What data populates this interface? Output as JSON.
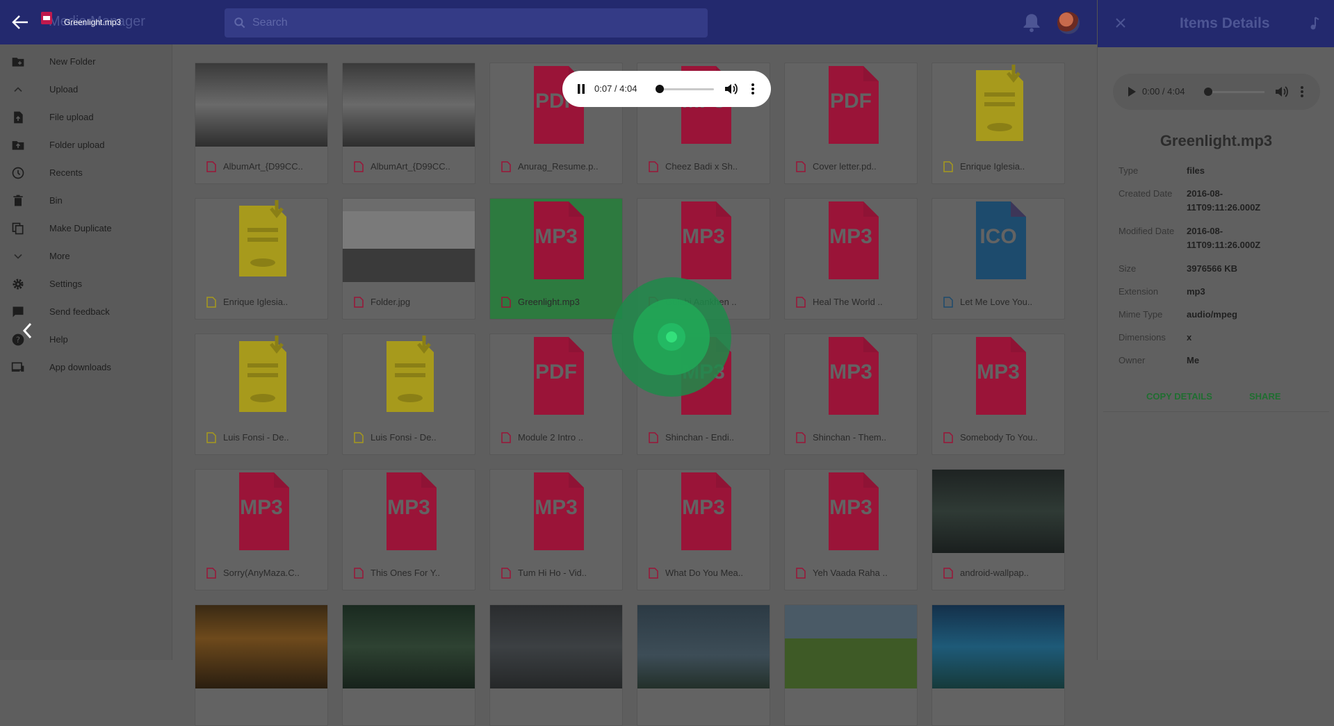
{
  "topbar": {
    "app_title_behind": "Media Manager",
    "player_title": "Greenlight.mp3",
    "search_placeholder": "Search"
  },
  "sidebar": {
    "items": [
      {
        "label": "New Folder",
        "icon": "new-folder-icon"
      },
      {
        "label": "Upload",
        "icon": "chevron-up-icon"
      },
      {
        "label": "File upload",
        "icon": "file-upload-icon"
      },
      {
        "label": "Folder upload",
        "icon": "folder-upload-icon"
      },
      {
        "label": "Recents",
        "icon": "clock-icon"
      },
      {
        "label": "Bin",
        "icon": "trash-icon"
      },
      {
        "label": "Make Duplicate",
        "icon": "copy-icon"
      },
      {
        "label": "More",
        "icon": "chevron-down-icon"
      },
      {
        "label": "Settings",
        "icon": "gear-icon"
      },
      {
        "label": "Send feedback",
        "icon": "feedback-icon"
      },
      {
        "label": "Help",
        "icon": "help-icon"
      },
      {
        "label": "App downloads",
        "icon": "devices-icon"
      }
    ]
  },
  "files": [
    {
      "name": "AlbumArt_{D99CC..",
      "kind": "photo-bw"
    },
    {
      "name": "AlbumArt_{D99CC..",
      "kind": "photo-bw"
    },
    {
      "name": "Anurag_Resume.p..",
      "kind": "pdf",
      "badge": "PDF"
    },
    {
      "name": "Cheez Badi x Sh..",
      "kind": "mp3",
      "badge": "MP3"
    },
    {
      "name": "Cover letter.pd..",
      "kind": "pdf",
      "badge": "PDF"
    },
    {
      "name": "Enrique Iglesia..",
      "kind": "doc"
    },
    {
      "name": "Enrique Iglesia..",
      "kind": "doc"
    },
    {
      "name": "Folder.jpg",
      "kind": "photo-band"
    },
    {
      "name": "Greenlight.mp3",
      "kind": "mp3",
      "badge": "MP3",
      "selected": true
    },
    {
      "name": "Gulabi Aankhen ..",
      "kind": "mp3",
      "badge": "MP3"
    },
    {
      "name": "Heal The World ..",
      "kind": "mp3",
      "badge": "MP3"
    },
    {
      "name": "Let Me Love You..",
      "kind": "ico",
      "badge": "ICO"
    },
    {
      "name": "Luis Fonsi - De..",
      "kind": "doc"
    },
    {
      "name": "Luis Fonsi - De..",
      "kind": "doc"
    },
    {
      "name": "Module 2 Intro ..",
      "kind": "pdf",
      "badge": "PDF"
    },
    {
      "name": "Shinchan - Endi..",
      "kind": "mp3",
      "badge": "MP3"
    },
    {
      "name": "Shinchan - Them..",
      "kind": "mp3",
      "badge": "MP3"
    },
    {
      "name": "Somebody To You..",
      "kind": "mp3",
      "badge": "MP3"
    },
    {
      "name": "Sorry(AnyMaza.C..",
      "kind": "mp3",
      "badge": "MP3"
    },
    {
      "name": "This Ones For Y..",
      "kind": "mp3",
      "badge": "MP3"
    },
    {
      "name": "Tum Hi Ho - Vid..",
      "kind": "mp3",
      "badge": "MP3"
    },
    {
      "name": "What Do You Mea..",
      "kind": "mp3",
      "badge": "MP3"
    },
    {
      "name": "Yeh Vaada Raha ..",
      "kind": "mp3",
      "badge": "MP3"
    },
    {
      "name": "android-wallpap..",
      "kind": "photo-road"
    },
    {
      "name": "",
      "kind": "photo-sunset"
    },
    {
      "name": "",
      "kind": "photo-forest"
    },
    {
      "name": "",
      "kind": "photo-storm"
    },
    {
      "name": "",
      "kind": "photo-tree"
    },
    {
      "name": "",
      "kind": "photo-field"
    },
    {
      "name": "",
      "kind": "photo-night"
    }
  ],
  "player": {
    "time": "0:07 / 4:04",
    "progress_fraction": 0.03
  },
  "details": {
    "panel_title": "Items Details",
    "player_time": "0:00 / 4:04",
    "file_name": "Greenlight.mp3",
    "rows": [
      {
        "key": "Type",
        "value": "files"
      },
      {
        "key": "Created Date",
        "value": "2016-08-11T09:11:26.000Z"
      },
      {
        "key": "Modified Date",
        "value": "2016-08-11T09:11:26.000Z"
      },
      {
        "key": "Size",
        "value": "3976566 KB"
      },
      {
        "key": "Extension",
        "value": "mp3"
      },
      {
        "key": "Mime Type",
        "value": "audio/mpeg"
      },
      {
        "key": "Dimensions",
        "value": "x"
      },
      {
        "key": "Owner",
        "value": "Me"
      }
    ],
    "copy_label": "COPY DETAILS",
    "share_label": "SHARE"
  },
  "colors": {
    "appbar": "#23296e",
    "file_red": "#9a1438",
    "ico_blue": "#1d4b6d",
    "doc_yellow": "#a79a1c",
    "selected_green": "#2d7a3f",
    "action_green": "#1f6e30"
  }
}
